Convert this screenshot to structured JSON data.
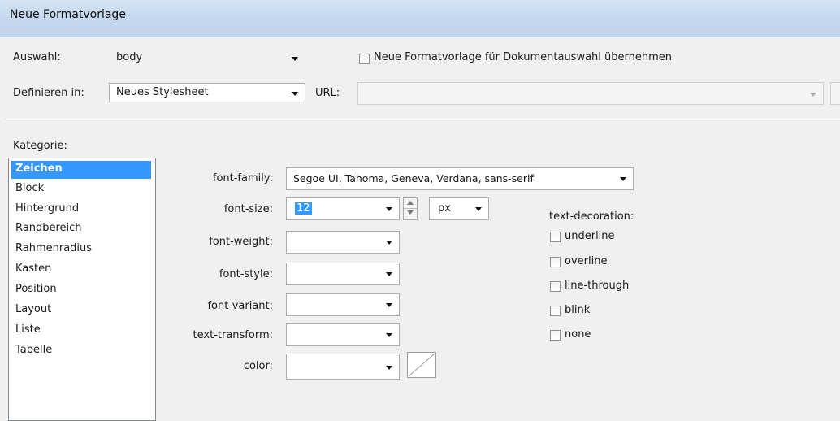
{
  "window": {
    "title": "Neue Formatvorlage"
  },
  "auswahl": {
    "label": "Auswahl:",
    "value": "body",
    "checkbox_label": "Neue Formatvorlage für Dokumentauswahl übernehmen"
  },
  "definieren": {
    "label": "Definieren in:",
    "value": "Neues Stylesheet",
    "url_label": "URL:",
    "url_value": ""
  },
  "kategorie": {
    "label": "Kategorie:",
    "items": [
      "Zeichen",
      "Block",
      "Hintergrund",
      "Randbereich",
      "Rahmenradius",
      "Kasten",
      "Position",
      "Layout",
      "Liste",
      "Tabelle"
    ],
    "selected": "Zeichen"
  },
  "props": {
    "font_family": {
      "label": "font-family:",
      "value": "Segoe UI, Tahoma, Geneva, Verdana, sans-serif"
    },
    "font_size": {
      "label": "font-size:",
      "value": "12",
      "unit": "px"
    },
    "font_weight": {
      "label": "font-weight:",
      "value": ""
    },
    "font_style": {
      "label": "font-style:",
      "value": ""
    },
    "font_variant": {
      "label": "font-variant:",
      "value": ""
    },
    "text_transform": {
      "label": "text-transform:",
      "value": ""
    },
    "color": {
      "label": "color:",
      "value": ""
    }
  },
  "text_decoration": {
    "label": "text-decoration:",
    "options": [
      "underline",
      "overline",
      "line-through",
      "blink",
      "none"
    ]
  },
  "colors": {
    "selection": "#3399ff",
    "titlebar": "#c2d6ee"
  },
  "icons": [
    "chevron-down-icon",
    "spin-up-icon",
    "spin-down-icon",
    "color-swatch-icon"
  ]
}
